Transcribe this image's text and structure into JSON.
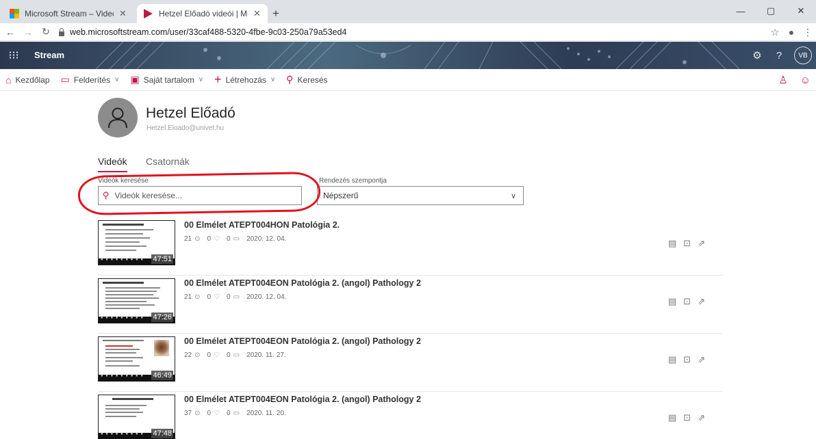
{
  "browser": {
    "tabs": [
      {
        "title": "Microsoft Stream – Videómegosztás",
        "close": "✕"
      },
      {
        "title": "Hetzel Előadó videói | Microsoft Stream",
        "close": "✕"
      }
    ],
    "new_tab": "+",
    "window_buttons": {
      "minimize": "—",
      "maximize": "▢",
      "close": "✕"
    },
    "url": "web.microsoftstream.com/user/33caf488-5320-4fbe-9c03-250a79a53ed4"
  },
  "header": {
    "brand": "Stream",
    "avatar_initials": "VB"
  },
  "nav": {
    "home": "Kezdőlap",
    "discover": "Felderítés",
    "my_content": "Saját tartalom",
    "create": "Létrehozás",
    "search": "Keresés"
  },
  "profile": {
    "name": "Hetzel Előadó",
    "email": "Hetzel.Eloado@univet.hu"
  },
  "tabs": {
    "videos": "Videók",
    "channels": "Csatornák"
  },
  "search": {
    "label": "Videók keresése",
    "placeholder": "Videók keresése..."
  },
  "sort": {
    "label": "Rendezés szempontja",
    "value": "Népszerű"
  },
  "videos": [
    {
      "title": "00 Elmélet ATEPT004HON Patológia 2.",
      "views": "21",
      "likes": "0",
      "comments": "0",
      "date": "2020. 12. 04.",
      "duration": "47:51",
      "slide": "Cerebrum"
    },
    {
      "title": "00 Elmélet ATEPT004EON Patológia 2. (angol) Pathology 2",
      "views": "21",
      "likes": "0",
      "comments": "0",
      "date": "2020. 12. 04.",
      "duration": "47:26",
      "slide": "Myocarditis"
    },
    {
      "title": "00 Elmélet ATEPT004EON Patológia 2. (angol) Pathology 2",
      "views": "22",
      "likes": "0",
      "comments": "0",
      "date": "2020. 11. 27.",
      "duration": "46:49",
      "slide": "General pathology of cephalic area"
    },
    {
      "title": "00 Elmélet ATEPT004EON Patológia 2. (angol) Pathology 2",
      "views": "37",
      "likes": "0",
      "comments": "0",
      "date": "2020. 11. 20.",
      "duration": "47:48",
      "slide": "Mycoplasma gallisepticum"
    }
  ],
  "colors": {
    "accent": "#bc1948",
    "annotation": "#e0121e"
  }
}
